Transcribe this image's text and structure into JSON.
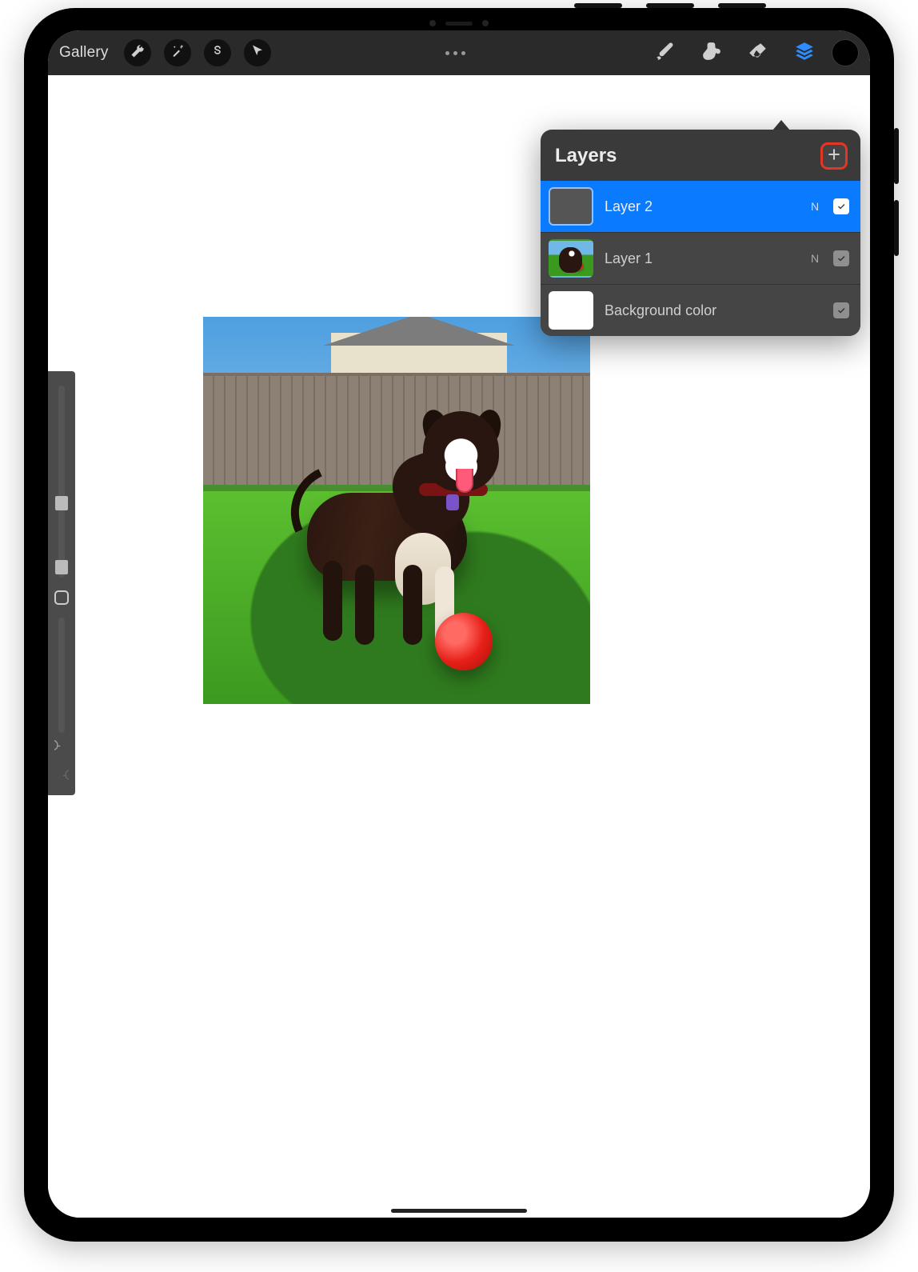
{
  "toolbar": {
    "gallery_label": "Gallery",
    "icons": {
      "wrench": "wrench-icon",
      "wand": "magic-wand-icon",
      "selection": "selection-s-icon",
      "move": "arrow-cursor-icon",
      "brush": "brush-icon",
      "smudge": "smudge-icon",
      "eraser": "eraser-icon",
      "layers": "layers-icon",
      "color": "color-swatch-icon"
    }
  },
  "layers_panel": {
    "title": "Layers",
    "add_icon": "plus-icon",
    "layers": [
      {
        "name": "Layer 2",
        "blend": "N",
        "visible": true,
        "selected": true,
        "thumb": "blank"
      },
      {
        "name": "Layer 1",
        "blend": "N",
        "visible": true,
        "selected": false,
        "thumb": "photo"
      },
      {
        "name": "Background color",
        "blend": "",
        "visible": true,
        "selected": false,
        "thumb": "white"
      }
    ]
  },
  "sidebar": {
    "undo_icon": "undo-icon",
    "redo_icon": "redo-icon"
  },
  "canvas": {
    "content_description": "Photo of a black-and-white dog on grass with a red ball, wooden fence and house behind"
  }
}
